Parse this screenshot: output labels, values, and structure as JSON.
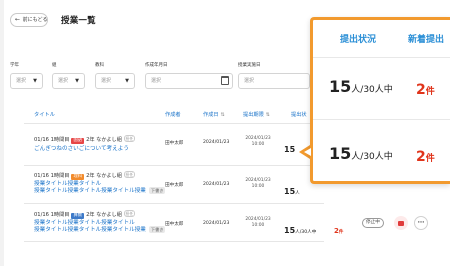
{
  "header": {
    "back_label": "前にもどる",
    "title": "授業一覧"
  },
  "filters": [
    {
      "label": "学年",
      "placeholder": "選択"
    },
    {
      "label": "組",
      "placeholder": "選択"
    },
    {
      "label": "教科",
      "placeholder": "選択"
    },
    {
      "label": "作成年月日",
      "placeholder": "選択"
    },
    {
      "label": "授業実施日",
      "placeholder": "選択"
    }
  ],
  "table": {
    "columns": {
      "title": "タイトル",
      "author": "作成者",
      "created": "作成日",
      "deadline": "提出期限",
      "submission": "提出状"
    },
    "rows": [
      {
        "meta_date": "01/16 1時間目",
        "subject": "国語",
        "subject_color": "#e74646",
        "class": "2年 なかよし組",
        "pill": "担任",
        "title": "ごんぎつねのさいごについて考えよう",
        "title_line2": "",
        "draft": "",
        "author": "田中太郎",
        "created": "2024/01/23",
        "deadline_date": "2024/01/23",
        "deadline_time": "10:00",
        "submitted": "15",
        "submitted_unit": "人",
        "total": "/30人中",
        "new_count": "",
        "new_unit": "",
        "status": ""
      },
      {
        "meta_date": "01/16 1時間目",
        "subject": "理科",
        "subject_color": "#f28b2c",
        "class": "2年 なかよし組",
        "pill": "担任",
        "title": "授業タイトル授業タイトル",
        "title_line2": "授業タイトル授業タイトル授業タイトル授業",
        "draft": "下書き",
        "author": "田中太郎",
        "created": "2024/01/23",
        "deadline_date": "2024/01/23",
        "deadline_time": "10:00",
        "submitted": "15",
        "submitted_unit": "人",
        "total": "/30人中",
        "new_count": "",
        "new_unit": "",
        "status": ""
      },
      {
        "meta_date": "01/16 1時間目",
        "subject": "算数",
        "subject_color": "#3d7ac9",
        "class": "2年 なかよし組",
        "pill": "担任",
        "title": "授業タイトル授業タイトル授業タイトル",
        "title_line2": "授業タイトル授業タイトル授業タイトル授業",
        "draft": "下書き",
        "author": "田中太郎",
        "created": "2024/01/23",
        "deadline_date": "2024/01/23",
        "deadline_time": "10:00",
        "submitted": "15",
        "submitted_unit": "人",
        "total": "/30人中",
        "new_count": "2",
        "new_unit": "件",
        "status": "停止中"
      }
    ]
  },
  "callout": {
    "headers": {
      "submission": "提出状況",
      "new": "新着提出"
    },
    "rows": [
      {
        "submitted": "15",
        "unit": "人",
        "total": "/30人中",
        "new_count": "2",
        "new_unit": "件"
      },
      {
        "submitted": "15",
        "unit": "人",
        "total": "/30人中",
        "new_count": "2",
        "new_unit": "件"
      }
    ]
  },
  "colors": {
    "accent_blue": "#2b8fd6",
    "callout_border": "#f29a2e",
    "new_red": "#e0341b"
  }
}
